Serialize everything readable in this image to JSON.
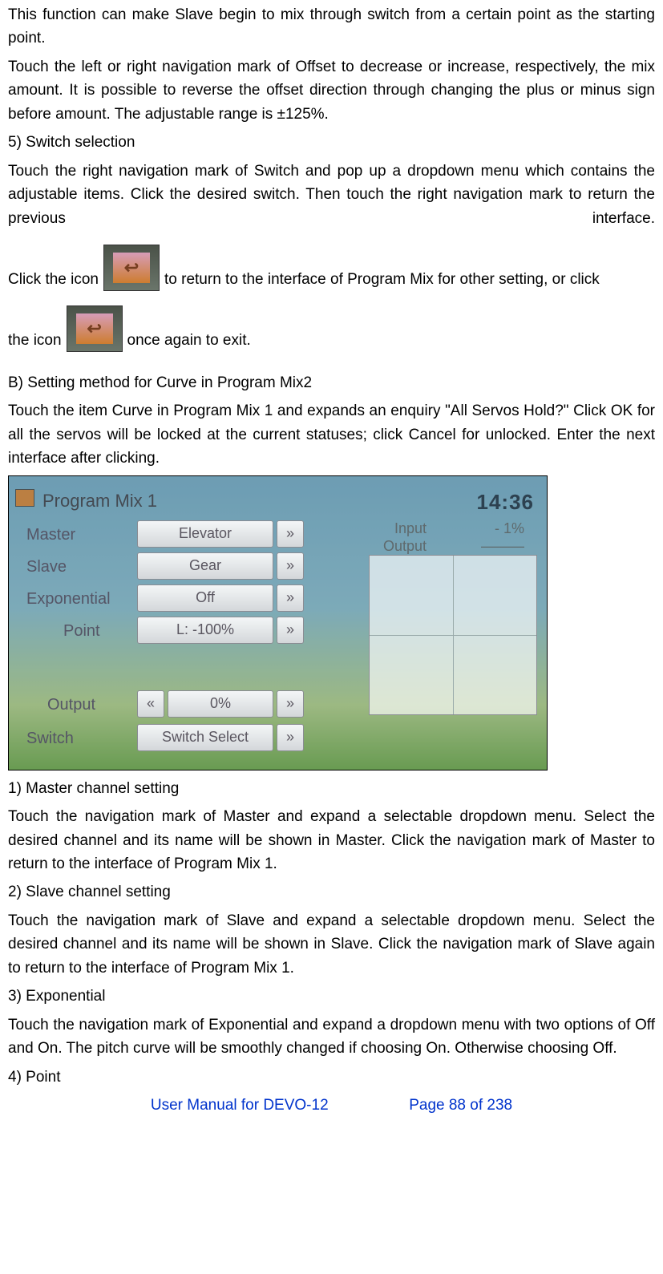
{
  "paragraphs": {
    "p1": "This function can make Slave begin to mix through switch from a certain point as the starting point.",
    "p2": "Touch the left or right navigation mark of Offset to decrease or increase, respectively, the mix amount. It is possible to reverse the offset direction through changing the plus or minus sign before amount. The adjustable range is ±125%.",
    "h5": "5)    Switch selection",
    "p3": "Touch the right navigation mark of Switch and pop up a dropdown menu which contains the adjustable items. Click the desired switch. Then touch the right navigation mark to return the previous interface.",
    "icon_line_a1": "Click the icon",
    "icon_line_a2": " to return to the interface of Program Mix for other setting, or click",
    "icon_line_b1": "the icon",
    "icon_line_b2": " once again to exit.",
    "hB": "B) Setting method for Curve in Program Mix2",
    "p4": "Touch the item Curve in Program Mix 1 and expands an enquiry \"All Servos Hold?\" Click OK for all the servos will be locked at the current statuses; click Cancel for unlocked. Enter the next interface after clicking.",
    "h1n": "1)  Master channel setting",
    "p5": "Touch the navigation mark of Master and expand a selectable dropdown menu. Select the desired channel and its name will be shown in Master. Click the navigation mark of Master to return to the interface of Program Mix 1.",
    "h2n": "2)  Slave channel setting",
    "p6": "Touch the navigation mark of Slave and expand a selectable dropdown menu. Select the desired channel and its name will be shown in Slave. Click the navigation mark of Slave again to return to the interface of Program Mix 1.",
    "h3n": "3)  Exponential",
    "p7": "Touch the navigation mark of Exponential and expand a dropdown menu with two options of Off and On. The pitch curve will be smoothly changed if choosing On. Otherwise choosing Off.",
    "h4n": "4)  Point"
  },
  "screenshot": {
    "title": "Program Mix 1",
    "time": "14:36",
    "labels": {
      "master": "Master",
      "slave": "Slave",
      "exponential": "Exponential",
      "point": "Point",
      "output": "Output",
      "switch": "Switch"
    },
    "fields": {
      "master": "Elevator",
      "slave": "Gear",
      "exponential": "Off",
      "point": "L: -100%",
      "output": "0%",
      "switch": "Switch Select"
    },
    "io": {
      "input_label": "Input",
      "input_value": "- 1%",
      "output_label": "Output",
      "output_value": "———"
    },
    "nav_prev": "«",
    "nav_next": "»"
  },
  "footer": {
    "left": "User Manual for DEVO-12",
    "right": "Page 88 of 238"
  }
}
